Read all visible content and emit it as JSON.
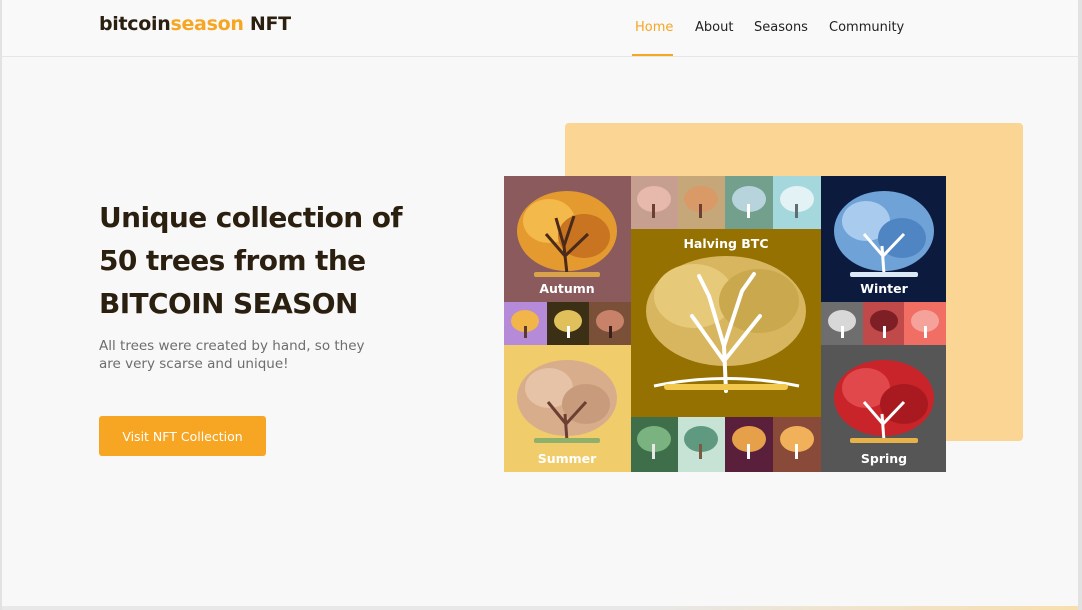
{
  "header": {
    "logo_part1": "bitcoin",
    "logo_part2": "season",
    "logo_part3": " NFT",
    "nav": [
      {
        "label": "Home",
        "active": true
      },
      {
        "label": "About",
        "active": false
      },
      {
        "label": "Seasons",
        "active": false
      },
      {
        "label": "Community",
        "active": false
      }
    ]
  },
  "hero": {
    "title_line1": "Unique collection of",
    "title_line2": "50 trees from the",
    "title_line3": "BITCOIN SEASON",
    "subtitle_line1": "All trees were created by hand, so they",
    "subtitle_line2": "are very scarse and unique!",
    "cta_label": "Visit NFT Collection"
  },
  "collage": {
    "labels": {
      "autumn": "Autumn",
      "halving": "Halving BTC",
      "winter": "Winter",
      "summer": "Summer",
      "spring": "Spring"
    }
  },
  "colors": {
    "accent": "#f6a623",
    "dark_text": "#2b1f10",
    "peach": "#fbd594"
  }
}
